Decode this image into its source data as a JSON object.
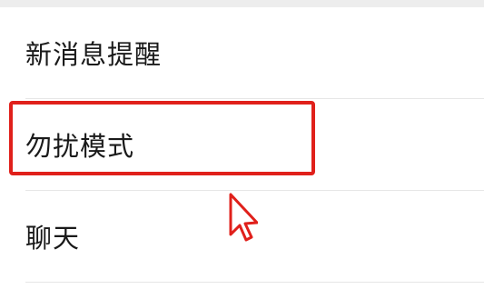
{
  "settings": {
    "items": [
      {
        "label": "新消息提醒"
      },
      {
        "label": "勿扰模式"
      },
      {
        "label": "聊天"
      }
    ]
  },
  "annotation": {
    "highlight_color": "#e0201b",
    "cursor_icon": "arrow-cursor-icon"
  }
}
